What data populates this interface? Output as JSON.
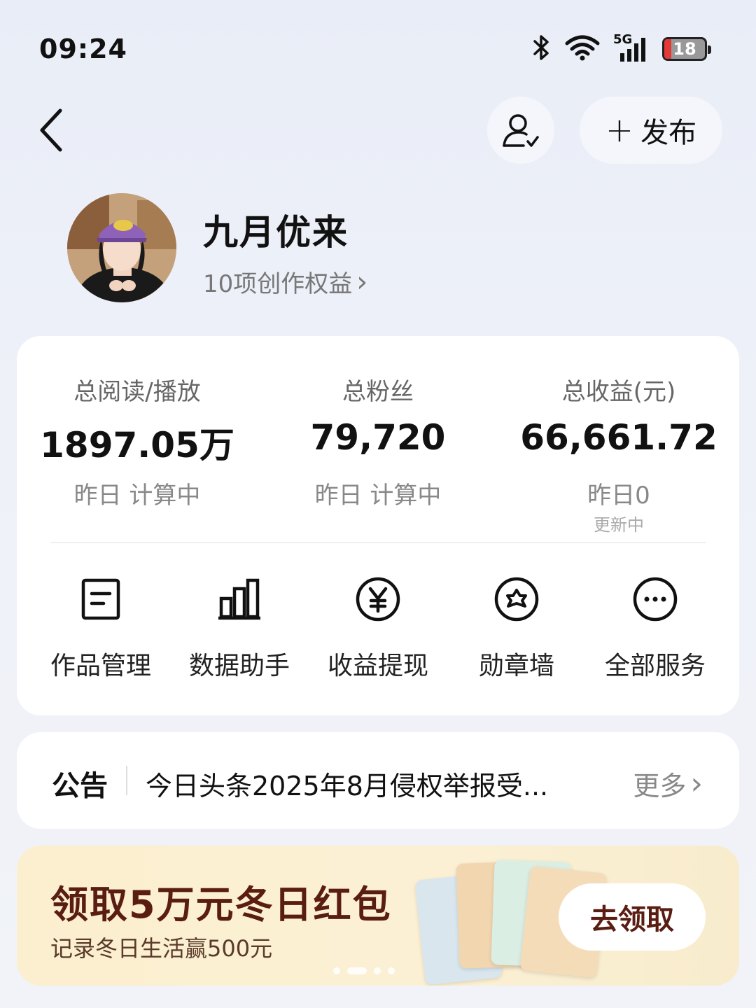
{
  "status_bar": {
    "time": "09:24",
    "network": "5G",
    "battery": "18",
    "icons": [
      "bluetooth-icon",
      "wifi-icon",
      "signal-icon",
      "battery-icon"
    ]
  },
  "header": {
    "back_icon": "chevron-left-icon",
    "profile_icon": "user-check-icon",
    "publish_plus": "+",
    "publish_label": "发布"
  },
  "profile": {
    "name": "九月优来",
    "rights_label": "10项创作权益",
    "rights_arrow": "›"
  },
  "stats": [
    {
      "label": "总阅读/播放",
      "value": "1897.05万",
      "sub": "昨日 计算中",
      "sub2": ""
    },
    {
      "label": "总粉丝",
      "value": "79,720",
      "sub": "昨日 计算中",
      "sub2": ""
    },
    {
      "label": "总收益(元)",
      "value": "66,661.72",
      "sub": "昨日0",
      "sub2": "更新中"
    }
  ],
  "services": [
    {
      "label": "作品管理",
      "icon": "document-icon"
    },
    {
      "label": "数据助手",
      "icon": "bar-chart-icon"
    },
    {
      "label": "收益提现",
      "icon": "yen-icon"
    },
    {
      "label": "勋章墙",
      "icon": "badge-icon"
    },
    {
      "label": "全部服务",
      "icon": "more-icon"
    }
  ],
  "notice": {
    "title": "公告",
    "text": "今日头条2025年8月侵权举报受...",
    "more": "更多",
    "more_arrow": "›"
  },
  "banner": {
    "title": "领取5万元冬日红包",
    "subtitle": "记录冬日生活赢500元",
    "button": "去领取",
    "carousel_pages": 4,
    "active_page": 2
  },
  "colors": {
    "banner_title": "#5a1d12",
    "battery_low": "#e53935"
  }
}
